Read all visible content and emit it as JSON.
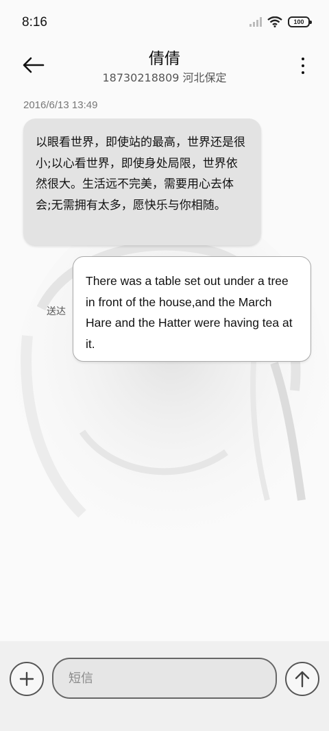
{
  "status_bar": {
    "time": "8:16",
    "battery": "100",
    "icons": [
      "signal-icon",
      "wifi-icon",
      "battery-icon"
    ]
  },
  "header": {
    "contact_name": "倩倩",
    "contact_subtitle": "18730218809 河北保定",
    "back_icon": "arrow-left-icon",
    "more_icon": "more-vertical-icon"
  },
  "conversation": {
    "timestamp": "2016/6/13 13:49",
    "messages": [
      {
        "direction": "incoming",
        "text": "以眼看世界，即使站的最高，世界还是很小;以心看世界，即使身处局限，世界依然很大。生活远不完美，需要用心去体会;无需拥有太多，愿快乐与你相随。"
      },
      {
        "direction": "outgoing",
        "status": "送达",
        "text": "There was a table set out under a tree in front of the house,and the March Hare and the Hatter were having tea at it."
      }
    ]
  },
  "composer": {
    "placeholder": "短信",
    "add_icon": "plus-icon",
    "send_icon": "arrow-up-icon"
  },
  "colors": {
    "incoming_bubble": "#e3e3e3",
    "outgoing_bubble": "#ffffff",
    "background": "#fafafa"
  }
}
